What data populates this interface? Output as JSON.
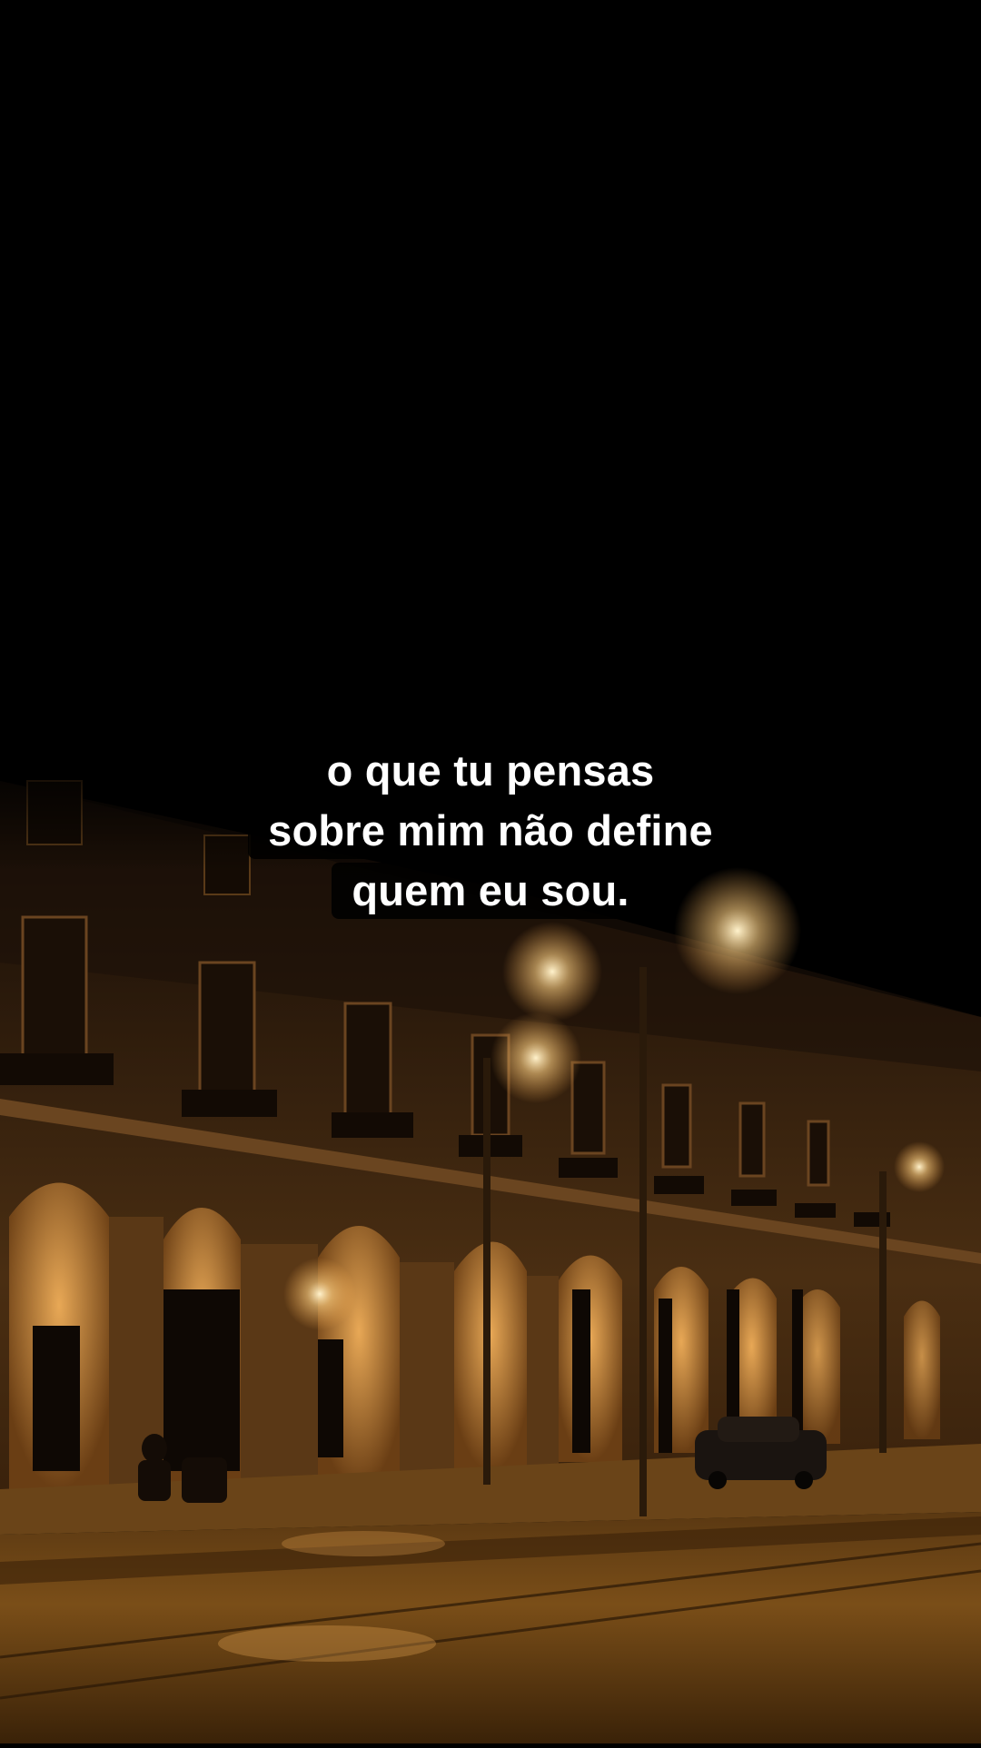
{
  "video_frame": {
    "scene_description_icon": "night-street-photo",
    "caption": {
      "lines": [
        "o que tu pensas",
        "sobre mim não define",
        "quem eu sou."
      ]
    },
    "colors": {
      "background": "#000000",
      "caption_text": "#ffffff",
      "caption_box": "#000000",
      "lamp_glow": "#ffd28a",
      "facade": "#3a2410"
    }
  }
}
